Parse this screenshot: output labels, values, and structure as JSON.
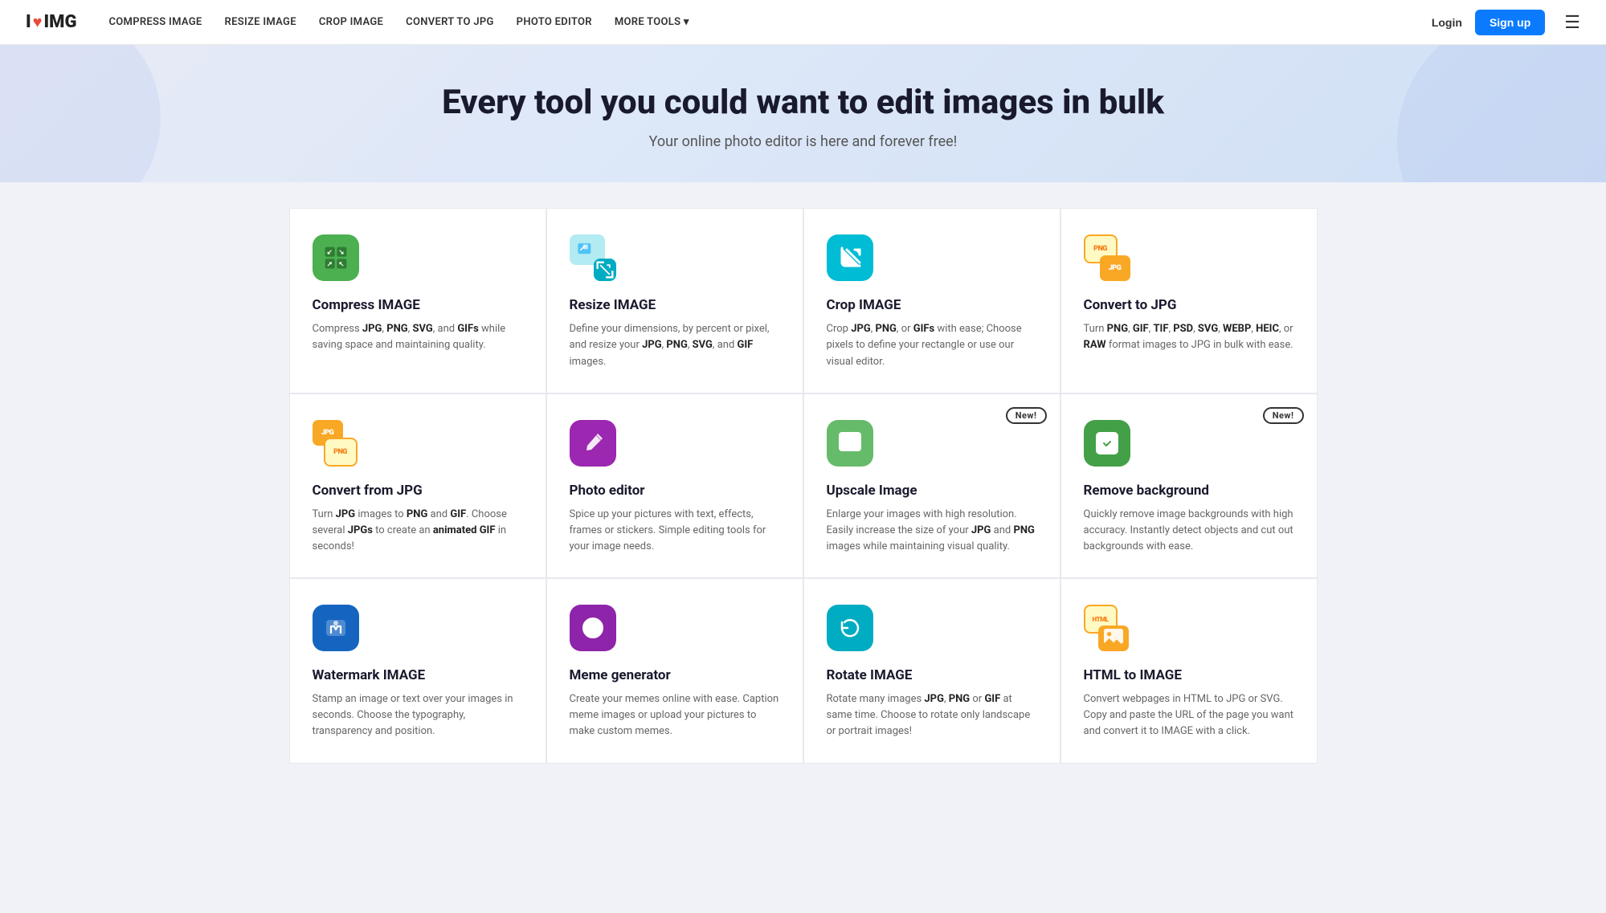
{
  "nav": {
    "logo_text": "I",
    "logo_img": "IMG",
    "links": [
      {
        "label": "COMPRESS IMAGE",
        "key": "compress"
      },
      {
        "label": "RESIZE IMAGE",
        "key": "resize"
      },
      {
        "label": "CROP IMAGE",
        "key": "crop"
      },
      {
        "label": "CONVERT TO JPG",
        "key": "convert"
      },
      {
        "label": "PHOTO EDITOR",
        "key": "photo"
      },
      {
        "label": "MORE TOOLS ▾",
        "key": "more"
      }
    ],
    "login": "Login",
    "signup": "Sign up"
  },
  "hero": {
    "title": "Every tool you could want to edit images in bulk",
    "subtitle": "Your online photo editor is here and forever free!"
  },
  "tools": [
    {
      "key": "compress",
      "title": "Compress IMAGE",
      "description_html": "Compress <b>JPG</b>, <b>PNG</b>, <b>SVG</b>, and <b>GIFs</b> while saving space and maintaining quality.",
      "icon_type": "compress",
      "icon_bg": "#4caf50",
      "badge": ""
    },
    {
      "key": "resize",
      "title": "Resize IMAGE",
      "description_html": "Define your dimensions, by percent or pixel, and resize your <b>JPG</b>, <b>PNG</b>, <b>SVG</b>, and <b>GIF</b> images.",
      "icon_type": "resize",
      "icon_bg": "#4db6c4",
      "badge": ""
    },
    {
      "key": "crop",
      "title": "Crop IMAGE",
      "description_html": "Crop <b>JPG</b>, <b>PNG</b>, or <b>GIFs</b> with ease; Choose pixels to define your rectangle or use our visual editor.",
      "icon_type": "crop",
      "icon_bg": "#00bcd4",
      "badge": ""
    },
    {
      "key": "convert-to-jpg",
      "title": "Convert to JPG",
      "description_html": "Turn <b>PNG</b>, <b>GIF</b>, <b>TIF</b>, <b>PSD</b>, <b>SVG</b>, <b>WEBP</b>, <b>HEIC</b>, or <b>RAW</b> format images to JPG in bulk with ease.",
      "icon_type": "convert-to-jpg",
      "icon_bg": "#f5c518",
      "badge": ""
    },
    {
      "key": "convert-from-jpg",
      "title": "Convert from JPG",
      "description_html": "Turn <b>JPG</b> images to <b>PNG</b> and <b>GIF</b>. Choose several <b>JPGs</b> to create an <b>animated GIF</b> in seconds!",
      "icon_type": "convert-from-jpg",
      "icon_bg": "#f5c518",
      "badge": ""
    },
    {
      "key": "photo-editor",
      "title": "Photo editor",
      "description_html": "Spice up your pictures with text, effects, frames or stickers. Simple editing tools for your image needs.",
      "icon_type": "photo-editor",
      "icon_bg": "#9c27b0",
      "badge": ""
    },
    {
      "key": "upscale",
      "title": "Upscale Image",
      "description_html": "Enlarge your images with high resolution. Easily increase the size of your <b>JPG</b> and <b>PNG</b> images while maintaining visual quality.",
      "icon_type": "upscale",
      "icon_bg": "#66bb6a",
      "badge": "New!"
    },
    {
      "key": "remove-bg",
      "title": "Remove background",
      "description_html": "Quickly remove image backgrounds with high accuracy. Instantly detect objects and cut out backgrounds with ease.",
      "icon_type": "remove-bg",
      "icon_bg": "#43a047",
      "badge": "New!"
    },
    {
      "key": "watermark",
      "title": "Watermark IMAGE",
      "description_html": "Stamp an image or text over your images in seconds. Choose the typography, transparency and position.",
      "icon_type": "watermark",
      "icon_bg": "#1565c0",
      "badge": ""
    },
    {
      "key": "meme",
      "title": "Meme generator",
      "description_html": "Create your memes online with ease. Caption meme images or upload your pictures to make custom memes.",
      "icon_type": "meme",
      "icon_bg": "#8e24aa",
      "badge": ""
    },
    {
      "key": "rotate",
      "title": "Rotate IMAGE",
      "description_html": "Rotate many images <b>JPG</b>, <b>PNG</b> or <b>GIF</b> at same time. Choose to rotate only landscape or portrait images!",
      "icon_type": "rotate",
      "icon_bg": "#00acc1",
      "badge": ""
    },
    {
      "key": "html-to-image",
      "title": "HTML to IMAGE",
      "description_html": "Convert webpages in HTML to JPG or SVG. Copy and paste the URL of the page you want and convert it to IMAGE with a click.",
      "icon_type": "html-to-image",
      "icon_bg": "#f9a825",
      "badge": ""
    }
  ]
}
